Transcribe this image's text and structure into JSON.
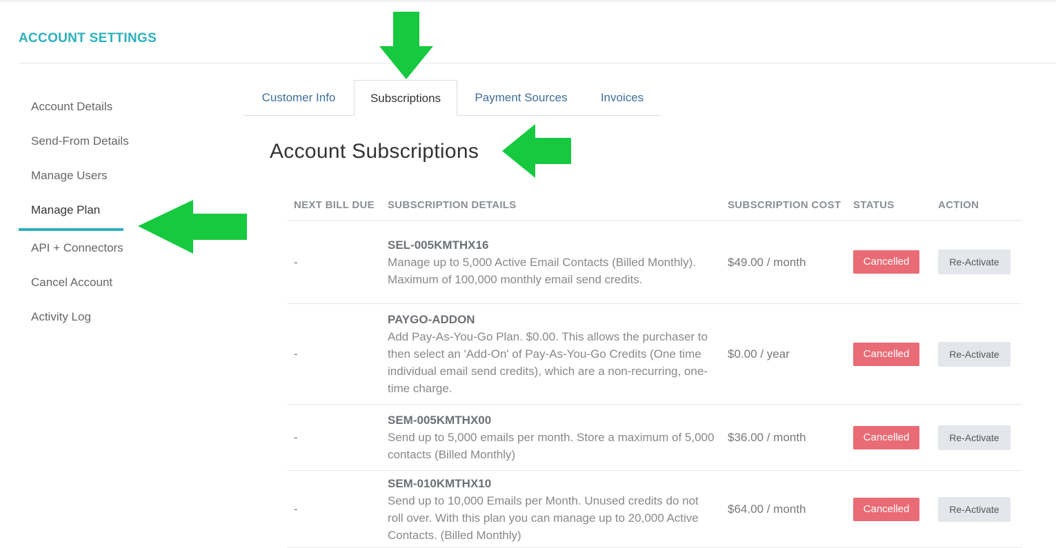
{
  "page": {
    "title": "ACCOUNT SETTINGS"
  },
  "sidebar": {
    "items": [
      {
        "label": "Account Details"
      },
      {
        "label": "Send-From Details"
      },
      {
        "label": "Manage Users"
      },
      {
        "label": "Manage Plan",
        "active": true
      },
      {
        "label": "API + Connectors"
      },
      {
        "label": "Cancel Account"
      },
      {
        "label": "Activity Log"
      }
    ]
  },
  "tabs": [
    {
      "label": "Customer Info"
    },
    {
      "label": "Subscriptions",
      "active": true
    },
    {
      "label": "Payment Sources"
    },
    {
      "label": "Invoices"
    }
  ],
  "section": {
    "heading": "Account Subscriptions"
  },
  "table": {
    "columns": [
      "NEXT BILL DUE",
      "SUBSCRIPTION DETAILS",
      "SUBSCRIPTION COST",
      "STATUS",
      "ACTION"
    ],
    "rows": [
      {
        "next_bill": "-",
        "code": "SEL-005KMTHX16",
        "description": "Manage up to 5,000 Active Email Contacts (Billed Monthly). Maximum of 100,000 monthly email send credits.",
        "cost": "$49.00 / month",
        "status": "Cancelled",
        "action": "Re-Activate"
      },
      {
        "next_bill": "-",
        "code": "PAYGO-ADDON",
        "description": "Add Pay-As-You-Go Plan. $0.00. This allows the purchaser to then select an 'Add-On' of Pay-As-You-Go Credits (One time individual email send credits), which are a non-recurring, one-time charge.",
        "cost": "$0.00 / year",
        "status": "Cancelled",
        "action": "Re-Activate"
      },
      {
        "next_bill": "-",
        "code": "SEM-005KMTHX00",
        "description": "Send up to 5,000 emails per month. Store a maximum of 5,000 contacts (Billed Monthly)",
        "cost": "$36.00 / month",
        "status": "Cancelled",
        "action": "Re-Activate"
      },
      {
        "next_bill": "-",
        "code": "SEM-010KMTHX10",
        "description": "Send up to 10,000 Emails per Month. Unused credits do not roll over. With this plan you can manage up to 20,000 Active Contacts. (Billed Monthly)",
        "cost": "$64.00 / month",
        "status": "Cancelled",
        "action": "Re-Activate"
      }
    ]
  },
  "colors": {
    "accent": "#2bb0bd",
    "status_cancelled": "#e96b75",
    "tab_link": "#3f6e9b",
    "annotation_arrow": "#16c93f"
  }
}
